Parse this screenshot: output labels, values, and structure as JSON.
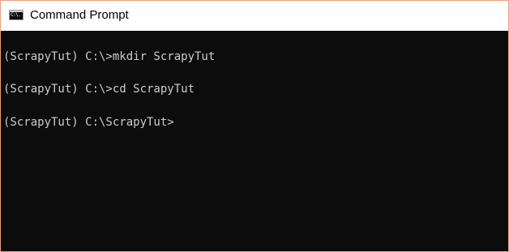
{
  "window": {
    "title": "Command Prompt",
    "icon": "cmd-icon",
    "icon_glyph": "C:\\."
  },
  "console": {
    "lines": [
      "(ScrapyTut) C:\\>mkdir ScrapyTut",
      "(ScrapyTut) C:\\>cd ScrapyTut",
      "(ScrapyTut) C:\\ScrapyTut>"
    ]
  },
  "colors": {
    "console_background": "#0c0c0c",
    "console_text": "#cccccc",
    "window_border": "#e8a27c"
  }
}
